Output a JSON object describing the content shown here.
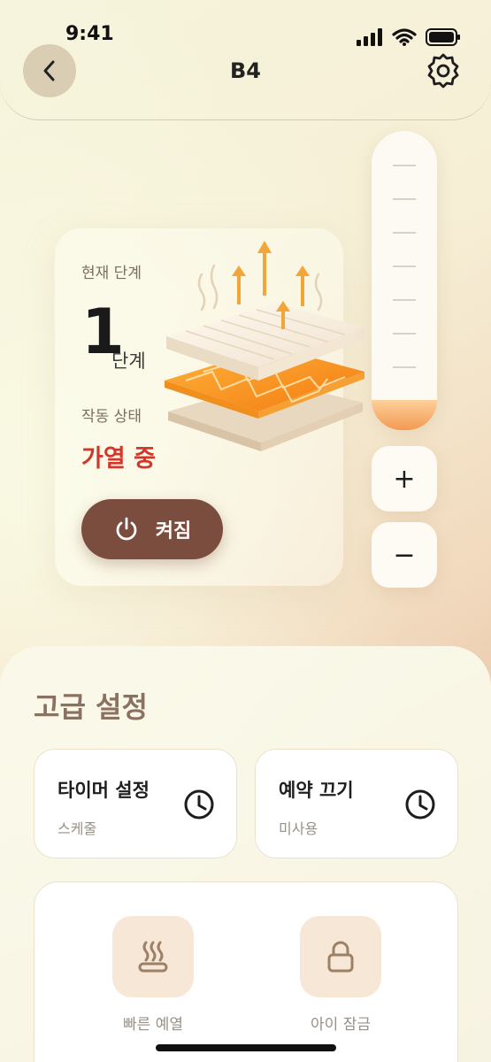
{
  "status_bar": {
    "time": "9:41"
  },
  "header": {
    "title": "B4",
    "back_icon": "chevron-left-icon",
    "settings_icon": "gear-icon"
  },
  "status_card": {
    "current_stage_label": "현재 단계",
    "stage_value": "1",
    "stage_unit": "단계",
    "operation_status_label": "작동 상태",
    "operation_status_value": "가열 중",
    "power_button_label": "켜짐",
    "status_color": "#d0382c",
    "power_button_color": "#7a4d3e"
  },
  "level_slider": {
    "level_fraction": 0.1,
    "fill_color": "#f39a52"
  },
  "controls": {
    "plus": "+",
    "minus": "−"
  },
  "advanced": {
    "title": "고급 설정",
    "timer": {
      "title": "타이머 설정",
      "subtitle": "스케줄",
      "icon": "clock-icon"
    },
    "reservation_off": {
      "title": "예약 끄기",
      "subtitle": "미사용",
      "icon": "clock-icon"
    },
    "quick_preheat": {
      "label": "빠른 예열",
      "icon": "heat-waves-icon"
    },
    "child_lock": {
      "label": "아이 잠금",
      "icon": "lock-icon"
    }
  }
}
